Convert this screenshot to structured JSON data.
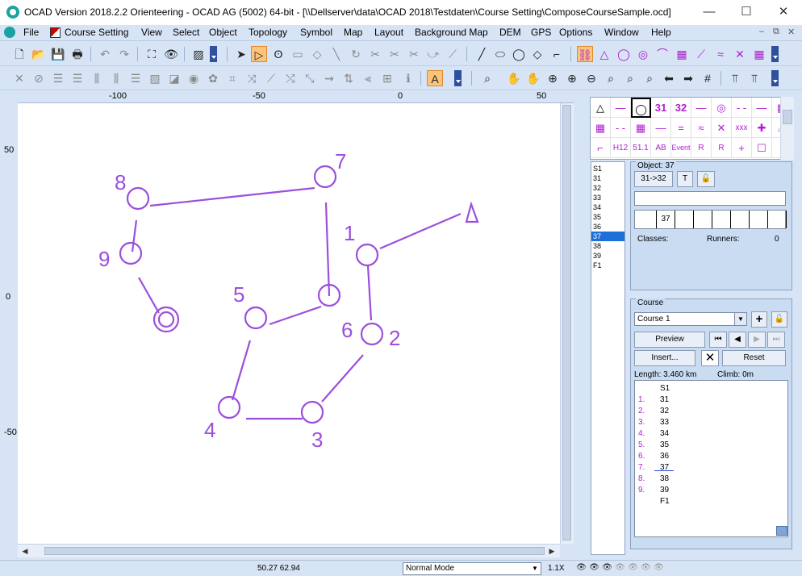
{
  "window": {
    "title": "OCAD Version 2018.2.2  Orienteering - OCAD AG (5002) 64-bit - [\\\\Dellserver\\data\\OCAD 2018\\Testdaten\\Course Setting\\ComposeCourseSample.ocd]",
    "minimize": "—",
    "maximize": "☐",
    "close": "✕"
  },
  "menu": {
    "items": [
      "File",
      "Course Setting",
      "View",
      "Select",
      "Object",
      "Topology",
      "Symbol",
      "Map",
      "Layout",
      "Background Map",
      "DEM",
      "GPS",
      "Options",
      "Window",
      "Help"
    ],
    "mdi_minimize": "–",
    "mdi_restore": "⧉",
    "mdi_close": "✕"
  },
  "ruler": {
    "top_labels": [
      "-100",
      "-50",
      "0",
      "50"
    ],
    "left_labels": [
      "50",
      "0",
      "-50"
    ]
  },
  "course_map": {
    "color": "#9b4fdc",
    "start_label": "",
    "controls": [
      {
        "number": "1"
      },
      {
        "number": "2"
      },
      {
        "number": "3"
      },
      {
        "number": "4"
      },
      {
        "number": "5"
      },
      {
        "number": "6"
      },
      {
        "number": "7"
      },
      {
        "number": "8"
      },
      {
        "number": "9"
      }
    ]
  },
  "symbol_box": {
    "row1": [
      "△",
      "—",
      "◯",
      "31",
      "32",
      "—",
      "◎",
      "- -",
      "—",
      "▦"
    ],
    "row2": [
      "▦",
      "- -",
      "▦",
      "—",
      "=",
      "≈",
      "✕",
      "xxx",
      "✚",
      "⌓"
    ],
    "row3": [
      "⌐",
      "H12",
      "51.1",
      "AB",
      "Event",
      "R",
      "R",
      "+",
      "☐",
      "↑"
    ]
  },
  "object_list": [
    "S1",
    "31",
    "32",
    "33",
    "34",
    "35",
    "36",
    "37",
    "38",
    "39",
    "F1"
  ],
  "object_panel": {
    "label": "Object: 37",
    "button_31_32": "31->32",
    "button_t": "T",
    "code_value": "37",
    "classes_label": "Classes:",
    "runners_label": "Runners:",
    "runners_value": "0"
  },
  "course_panel": {
    "label": "Course",
    "course_name": "Course 1",
    "preview_label": "Preview",
    "insert_label": "Insert...",
    "reset_label": "Reset",
    "length": "Length: 3.460 km",
    "climb": "Climb: 0m",
    "legs": [
      {
        "num": "",
        "code": "S1"
      },
      {
        "num": "1.",
        "code": "31"
      },
      {
        "num": "2.",
        "code": "32"
      },
      {
        "num": "3.",
        "code": "33"
      },
      {
        "num": "4.",
        "code": "34"
      },
      {
        "num": "5.",
        "code": "35"
      },
      {
        "num": "6.",
        "code": "36"
      },
      {
        "num": "7.",
        "code": "37"
      },
      {
        "num": "8.",
        "code": "38"
      },
      {
        "num": "9.",
        "code": "39"
      },
      {
        "num": "",
        "code": "F1"
      }
    ]
  },
  "status": {
    "coords": "50.27   62.94",
    "mode": "Normal Mode",
    "zoom": "1.1X"
  }
}
